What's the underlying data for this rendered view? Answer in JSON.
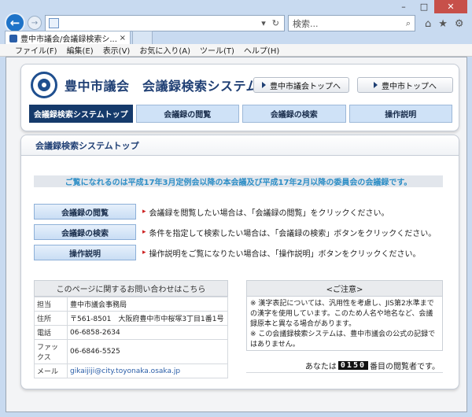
{
  "browser": {
    "search_placeholder": "検索...",
    "tab_title": "豊中市議会/会議録検索シ...",
    "menu": [
      "ファイル(F)",
      "編集(E)",
      "表示(V)",
      "お気に入り(A)",
      "ツール(T)",
      "ヘルプ(H)"
    ],
    "window_controls": [
      "–",
      "□",
      "✕"
    ]
  },
  "header": {
    "title": "豊中市議会　会議録検索システム",
    "btn_council_top": "豊中市議会トップへ",
    "btn_city_top": "豊中市トップへ",
    "nav": [
      "会議録検索システムトップ",
      "会議録の閲覧",
      "会議録の検索",
      "操作説明"
    ]
  },
  "content": {
    "heading": "会議録検索システムトップ",
    "notice": "ご覧になれるのは平成17年3月定例会以降の本会議及び平成17年2月以降の委員会の会議録です。",
    "actions": [
      {
        "label": "会議録の閲覧",
        "desc": "会議録を閲覧したい場合は、「会議録の閲覧」をクリックください。"
      },
      {
        "label": "会議録の検索",
        "desc": "条件を指定して検索したい場合は、「会議録の検索」ボタンをクリックください。"
      },
      {
        "label": "操作説明",
        "desc": "操作説明をご覧になりたい場合は、「操作説明」ボタンをクリックください。"
      }
    ],
    "contact": {
      "title": "このページに関するお問い合わせはこちら",
      "rows": [
        {
          "k": "担当",
          "v": "豊中市議会事務局"
        },
        {
          "k": "住所",
          "v": "〒561-8501　大阪府豊中市中桜塚3丁目1番1号"
        },
        {
          "k": "電話",
          "v": "06-6858-2634"
        },
        {
          "k": "ファックス",
          "v": "06-6846-5525"
        },
        {
          "k": "メール",
          "v": "gikaijiji@city.toyonaka.osaka.jp"
        }
      ]
    },
    "caution": {
      "title": "<ご注意>",
      "line1": "※ 漢字表記については、汎用性を考慮し、JIS第2水準までの漢字を使用しています。このため人名や地名など、会議録原本と異なる場合があります。",
      "line2": "※ この会議録検索システムは、豊中市議会の公式の記録ではありません。"
    },
    "visitor": {
      "prefix": "あなたは",
      "count": "0150",
      "suffix": "番目の閲覧者です。"
    }
  }
}
